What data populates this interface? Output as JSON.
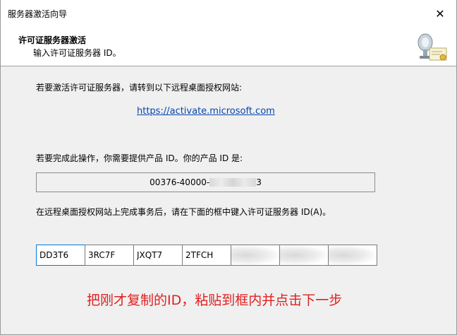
{
  "window": {
    "title": "服务器激活向导",
    "close_glyph": "✕"
  },
  "header": {
    "title": "许可证服务器激活",
    "subtitle": "输入许可证服务器 ID。"
  },
  "content": {
    "intro": "若要激活许可证服务器，请转到以下远程桌面授权网站:",
    "link": "https://activate.microsoft.com",
    "product_id_label": "若要完成此操作，你需要提供产品 ID。你的产品 ID 是:",
    "product_id_prefix": "00376-40000-",
    "product_id_suffix": "3",
    "server_id_label": "在远程桌面授权网站上完成事务后，请在下面的框中键入许可证服务器 ID(A)。",
    "server_id_fields": [
      "DD3T6",
      "3RC7F",
      "JXQT7",
      "2TFCH",
      "",
      "",
      ""
    ],
    "annotation": "把刚才复制的ID，粘贴到框内并点击下一步"
  },
  "colors": {
    "link": "#0645ad",
    "annotation": "#e02020",
    "focus_border": "#0078d7"
  },
  "icons": [
    "close-icon",
    "license-certificate-icon"
  ]
}
